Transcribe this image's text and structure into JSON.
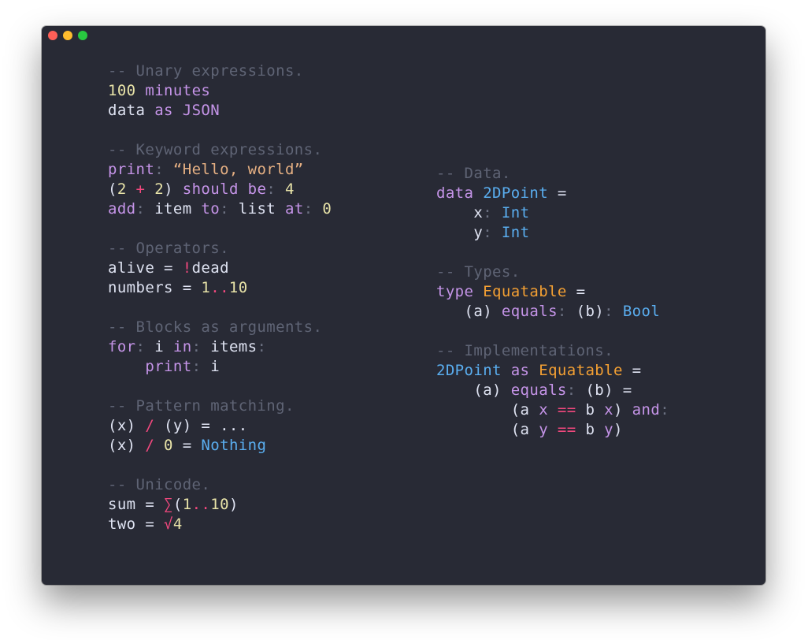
{
  "window": {
    "traffic_lights": [
      "close",
      "minimize",
      "zoom"
    ],
    "colors": {
      "background": "#282a35",
      "close": "#fe5f57",
      "minimize": "#febc2e",
      "zoom": "#28c840"
    }
  },
  "code": {
    "left_column": [
      [
        [
          "comment",
          "-- Unary expressions."
        ]
      ],
      [
        [
          "number",
          "100"
        ],
        [
          "plain",
          " "
        ],
        [
          "keyword",
          "minutes"
        ]
      ],
      [
        [
          "plain",
          "data "
        ],
        [
          "keyword",
          "as"
        ],
        [
          "plain",
          " "
        ],
        [
          "keyword",
          "JSON"
        ]
      ],
      [],
      [
        [
          "comment",
          "-- Keyword expressions."
        ]
      ],
      [
        [
          "keyword",
          "print"
        ],
        [
          "colon",
          ":"
        ],
        [
          "plain",
          " "
        ],
        [
          "string",
          "“Hello, world”"
        ]
      ],
      [
        [
          "plain",
          "("
        ],
        [
          "number",
          "2"
        ],
        [
          "plain",
          " "
        ],
        [
          "operator",
          "+"
        ],
        [
          "plain",
          " "
        ],
        [
          "number",
          "2"
        ],
        [
          "plain",
          ") "
        ],
        [
          "keyword",
          "should be"
        ],
        [
          "colon",
          ":"
        ],
        [
          "plain",
          " "
        ],
        [
          "number",
          "4"
        ]
      ],
      [
        [
          "keyword",
          "add"
        ],
        [
          "colon",
          ":"
        ],
        [
          "plain",
          " item "
        ],
        [
          "keyword",
          "to"
        ],
        [
          "colon",
          ":"
        ],
        [
          "plain",
          " list "
        ],
        [
          "keyword",
          "at"
        ],
        [
          "colon",
          ":"
        ],
        [
          "plain",
          " "
        ],
        [
          "number",
          "0"
        ]
      ],
      [],
      [
        [
          "comment",
          "-- Operators."
        ]
      ],
      [
        [
          "plain",
          "alive = "
        ],
        [
          "operator",
          "!"
        ],
        [
          "plain",
          "dead"
        ]
      ],
      [
        [
          "plain",
          "numbers = "
        ],
        [
          "number",
          "1"
        ],
        [
          "operator",
          ".."
        ],
        [
          "number",
          "10"
        ]
      ],
      [],
      [
        [
          "comment",
          "-- Blocks as arguments."
        ]
      ],
      [
        [
          "keyword",
          "for"
        ],
        [
          "colon",
          ":"
        ],
        [
          "plain",
          " i "
        ],
        [
          "keyword",
          "in"
        ],
        [
          "colon",
          ":"
        ],
        [
          "plain",
          " items"
        ],
        [
          "colon",
          ":"
        ]
      ],
      [
        [
          "plain",
          "    "
        ],
        [
          "keyword",
          "print"
        ],
        [
          "colon",
          ":"
        ],
        [
          "plain",
          " i"
        ]
      ],
      [],
      [
        [
          "comment",
          "-- Pattern matching."
        ]
      ],
      [
        [
          "plain",
          "(x) "
        ],
        [
          "operator",
          "/"
        ],
        [
          "plain",
          " (y) = ..."
        ]
      ],
      [
        [
          "plain",
          "(x) "
        ],
        [
          "operator",
          "/"
        ],
        [
          "plain",
          " "
        ],
        [
          "number",
          "0"
        ],
        [
          "plain",
          " = "
        ],
        [
          "type",
          "Nothing"
        ]
      ],
      [],
      [
        [
          "comment",
          "-- Unicode."
        ]
      ],
      [
        [
          "plain",
          "sum = "
        ],
        [
          "operator",
          "∑"
        ],
        [
          "plain",
          "("
        ],
        [
          "number",
          "1"
        ],
        [
          "operator",
          ".."
        ],
        [
          "number",
          "10"
        ],
        [
          "plain",
          ")"
        ]
      ],
      [
        [
          "plain",
          "two = "
        ],
        [
          "operator",
          "√"
        ],
        [
          "number",
          "4"
        ]
      ]
    ],
    "right_column": [
      [
        [
          "comment",
          "-- Data."
        ]
      ],
      [
        [
          "keyword",
          "data"
        ],
        [
          "plain",
          " "
        ],
        [
          "type",
          "2DPoint"
        ],
        [
          "plain",
          " ="
        ]
      ],
      [
        [
          "plain",
          "    x"
        ],
        [
          "colon",
          ":"
        ],
        [
          "plain",
          " "
        ],
        [
          "type",
          "Int"
        ]
      ],
      [
        [
          "plain",
          "    y"
        ],
        [
          "colon",
          ":"
        ],
        [
          "plain",
          " "
        ],
        [
          "type",
          "Int"
        ]
      ],
      [],
      [
        [
          "comment",
          "-- Types."
        ]
      ],
      [
        [
          "keyword",
          "type"
        ],
        [
          "plain",
          " "
        ],
        [
          "typedef",
          "Equatable"
        ],
        [
          "plain",
          " ="
        ]
      ],
      [
        [
          "plain",
          "   (a) "
        ],
        [
          "keyword",
          "equals"
        ],
        [
          "colon",
          ":"
        ],
        [
          "plain",
          " (b)"
        ],
        [
          "colon",
          ":"
        ],
        [
          "plain",
          " "
        ],
        [
          "type",
          "Bool"
        ]
      ],
      [],
      [
        [
          "comment",
          "-- Implementations."
        ]
      ],
      [
        [
          "type",
          "2DPoint"
        ],
        [
          "plain",
          " "
        ],
        [
          "keyword",
          "as"
        ],
        [
          "plain",
          " "
        ],
        [
          "typedef",
          "Equatable"
        ],
        [
          "plain",
          " ="
        ]
      ],
      [
        [
          "plain",
          "    (a) "
        ],
        [
          "keyword",
          "equals"
        ],
        [
          "colon",
          ":"
        ],
        [
          "plain",
          " (b) ="
        ]
      ],
      [
        [
          "plain",
          "        (a "
        ],
        [
          "keyword",
          "x"
        ],
        [
          "plain",
          " "
        ],
        [
          "operator",
          "=="
        ],
        [
          "plain",
          " b "
        ],
        [
          "keyword",
          "x"
        ],
        [
          "plain",
          ") "
        ],
        [
          "keyword",
          "and"
        ],
        [
          "colon",
          ":"
        ]
      ],
      [
        [
          "plain",
          "        (a "
        ],
        [
          "keyword",
          "y"
        ],
        [
          "plain",
          " "
        ],
        [
          "operator",
          "=="
        ],
        [
          "plain",
          " b "
        ],
        [
          "keyword",
          "y"
        ],
        [
          "plain",
          ")"
        ]
      ]
    ]
  }
}
